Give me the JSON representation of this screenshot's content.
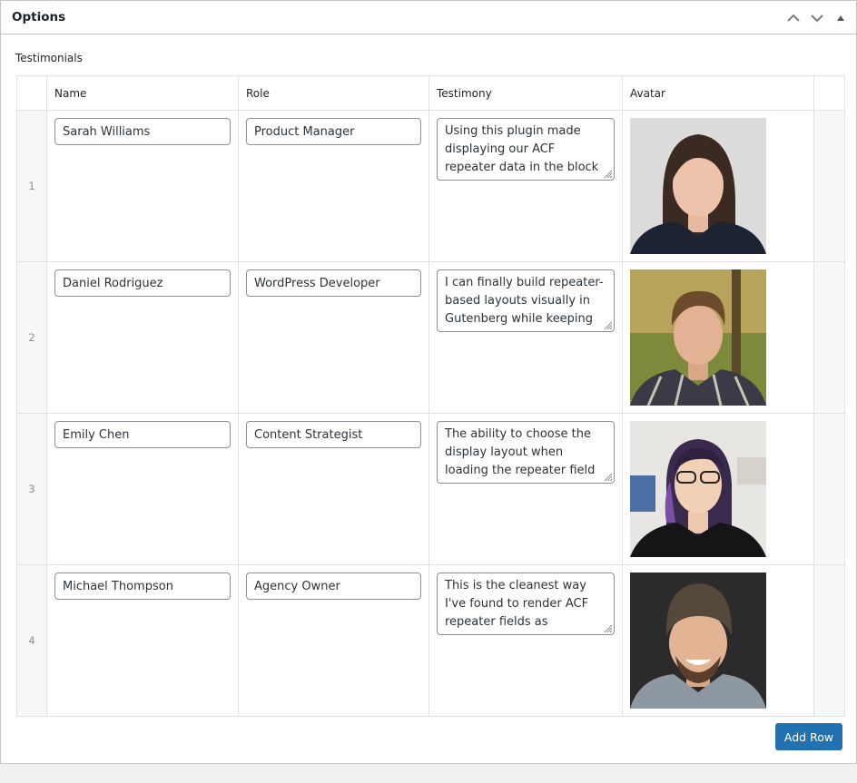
{
  "metabox": {
    "title": "Options"
  },
  "field": {
    "label": "Testimonials"
  },
  "table": {
    "headers": {
      "name": "Name",
      "role": "Role",
      "testimony": "Testimony",
      "avatar": "Avatar"
    },
    "rows": [
      {
        "order": "1",
        "name": "Sarah Williams",
        "role": "Product Manager",
        "testimony": "Using this plugin made displaying our ACF repeater data in the block editor"
      },
      {
        "order": "2",
        "name": "Daniel Rodriguez",
        "role": "WordPress Developer",
        "testimony": "I can finally build repeater-based layouts visually in Gutenberg while keeping my"
      },
      {
        "order": "3",
        "name": "Emily Chen",
        "role": "Content Strategist",
        "testimony": "The ability to choose the display layout when loading the repeater field saves a lot"
      },
      {
        "order": "4",
        "name": "Michael Thompson",
        "role": "Agency Owner",
        "testimony": "This is the cleanest way I've found to render ACF repeater fields as structured"
      }
    ]
  },
  "actions": {
    "add_row": "Add Row"
  },
  "icons": {
    "collapse": "chevron-up-icon",
    "expand": "chevron-down-icon",
    "toggle": "triangle-up-icon",
    "resize": "resize-grip-icon"
  },
  "colors": {
    "primary": "#2271b1",
    "border": "#c3c4c7"
  }
}
